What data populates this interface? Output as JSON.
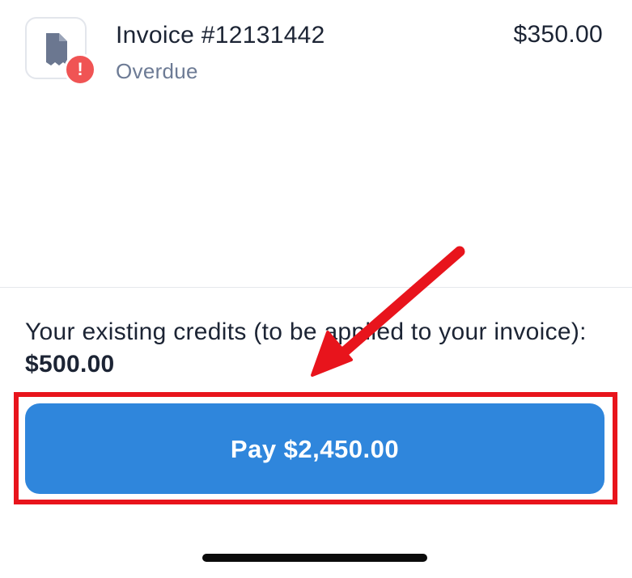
{
  "invoice": {
    "title": "Invoice #12131442",
    "status": "Overdue",
    "amount": "$350.00",
    "icon": "receipt-icon",
    "badge_icon": "alert-icon",
    "badge_text": "!",
    "badge_color": "#f05454"
  },
  "credits": {
    "text": "Your existing credits (to be applied to your invoice): ",
    "amount": "$500.00"
  },
  "pay_button": {
    "label": "Pay $2,450.00",
    "color": "#2f86dc"
  },
  "annotation": {
    "highlight_color": "#e8141c",
    "arrow_color": "#e8141c"
  }
}
